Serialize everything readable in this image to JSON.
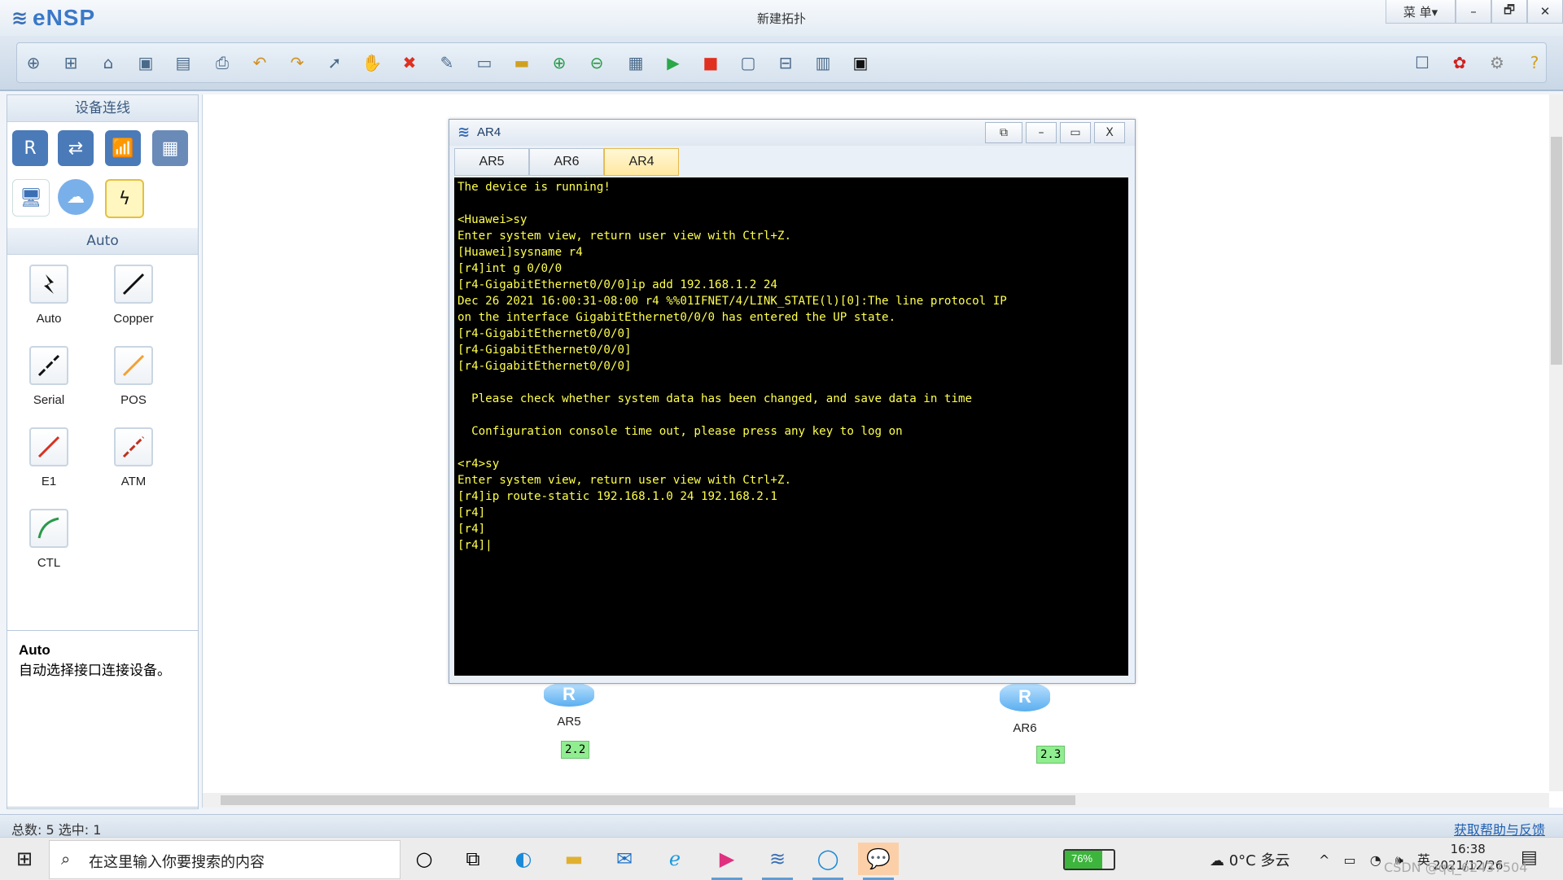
{
  "app": {
    "name": "eNSP",
    "window_title": "新建拓扑",
    "menu_label": "菜 单▾"
  },
  "window_controls": {
    "minimize": "–",
    "restore": "🗗",
    "close": "✕"
  },
  "toolbar": {
    "items": [
      "new-topology-icon",
      "new-project-icon",
      "open-icon",
      "save-icon",
      "save-as-icon",
      "print-icon",
      "undo-icon",
      "redo-icon",
      "select-icon",
      "pan-icon",
      "delete-icon",
      "delete-link-icon",
      "text-icon",
      "rectangle-icon",
      "zoom-in-icon",
      "zoom-out-icon",
      "fit-icon",
      "start-icon",
      "stop-icon",
      "capture-icon",
      "topology-icon",
      "grid-icon",
      "console-icon"
    ],
    "right_items": [
      "chat-icon",
      "huawei-icon",
      "settings-icon",
      "help-icon"
    ]
  },
  "left_panel": {
    "device_header": "设备连线",
    "devices": [
      "router",
      "switch",
      "wlan",
      "firewall",
      "pc",
      "cloud",
      "auto-connect"
    ],
    "cable_header": "Auto",
    "cables": [
      {
        "label": "Auto",
        "color": "#111111"
      },
      {
        "label": "Copper",
        "color": "#111111"
      },
      {
        "label": "Serial",
        "color": "#111111"
      },
      {
        "label": "POS",
        "color": "#f5a030"
      },
      {
        "label": "E1",
        "color": "#d83020"
      },
      {
        "label": "ATM",
        "color": "#c03020"
      },
      {
        "label": "CTL",
        "color": "#2a9a4a"
      }
    ],
    "description": {
      "title": "Auto",
      "text": "自动选择接口连接设备。"
    }
  },
  "console": {
    "title": "AR4",
    "tabs": [
      {
        "label": "AR5",
        "active": false
      },
      {
        "label": "AR6",
        "active": false
      },
      {
        "label": "AR4",
        "active": true
      }
    ],
    "lines": [
      "The device is running!",
      "",
      "<Huawei>sy",
      "Enter system view, return user view with Ctrl+Z.",
      "[Huawei]sysname r4",
      "[r4]int g 0/0/0",
      "[r4-GigabitEthernet0/0/0]ip add 192.168.1.2 24",
      "Dec 26 2021 16:00:31-08:00 r4 %%01IFNET/4/LINK_STATE(l)[0]:The line protocol IP",
      "on the interface GigabitEthernet0/0/0 has entered the UP state.",
      "[r4-GigabitEthernet0/0/0]",
      "[r4-GigabitEthernet0/0/0]",
      "[r4-GigabitEthernet0/0/0]",
      "",
      "  Please check whether system data has been changed, and save data in time",
      "",
      "  Configuration console time out, please press any key to log on",
      "",
      "<r4>sy",
      "Enter system view, return user view with Ctrl+Z.",
      "[r4]ip route-static 192.168.1.0 24 192.168.2.1",
      "[r4]",
      "[r4]",
      "[r4]|"
    ]
  },
  "topology": {
    "nodes": [
      {
        "label": "AR5",
        "ip": "2.2"
      },
      {
        "label": "AR6",
        "ip": "2.3"
      }
    ]
  },
  "status": {
    "left": "总数: 5 选中: 1",
    "right": "获取帮助与反馈"
  },
  "taskbar": {
    "search_placeholder": "在这里输入你要搜索的内容",
    "apps": [
      "cortana-icon",
      "task-view-icon",
      "edge-icon",
      "file-explorer-icon",
      "mail-icon",
      "ie-icon",
      "media-icon",
      "ensp-icon",
      "qq-browser-icon",
      "wechat-icon"
    ],
    "battery": "76%",
    "weather": "0°C 多云",
    "tray": "^ ▭ ◔ 🕪 英",
    "time": "16:38",
    "date": "2021/12/26",
    "watermark": "CSDN @qq_62437504"
  }
}
